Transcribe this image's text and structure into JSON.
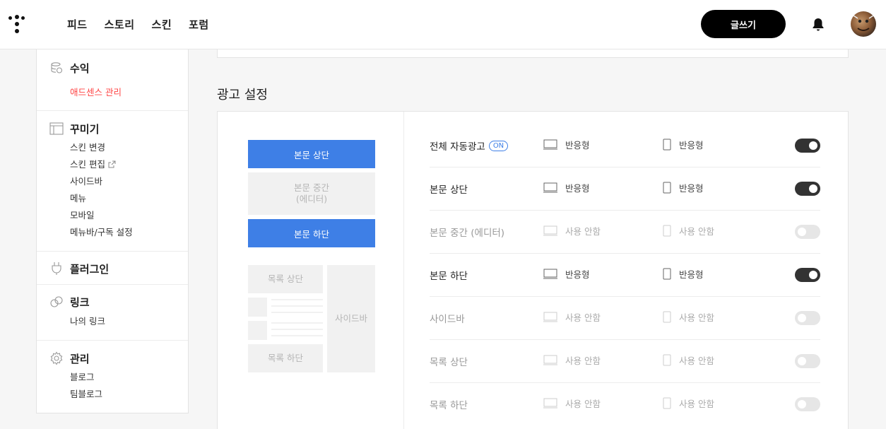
{
  "nav": [
    "피드",
    "스토리",
    "스킨",
    "포럼"
  ],
  "write_label": "글쓰기",
  "sidebar": {
    "revenue": {
      "title": "수익",
      "items": [
        "애드센스 관리"
      ]
    },
    "decorate": {
      "title": "꾸미기",
      "items": [
        "스킨 변경",
        "스킨 편집",
        "사이드바",
        "메뉴",
        "모바일",
        "메뉴바/구독 설정"
      ]
    },
    "plugin": {
      "title": "플러그인"
    },
    "link": {
      "title": "링크",
      "items": [
        "나의 링크"
      ]
    },
    "manage": {
      "title": "관리",
      "items": [
        "블로그",
        "팀블로그"
      ]
    }
  },
  "page_title": "광고 설정",
  "preview": {
    "body_top": "본문 상단",
    "body_middle": [
      "본문 중간",
      "(에디터)"
    ],
    "body_bottom": "본문 하단",
    "list_top": "목록 상단",
    "list_bottom": "목록 하단",
    "sidebar": "사이드바"
  },
  "on_badge": "ON",
  "rows": [
    {
      "label": "전체 자동광고",
      "badge": true,
      "pc": "반응형",
      "mobile": "반응형",
      "enabled": true
    },
    {
      "label": "본문 상단",
      "pc": "반응형",
      "mobile": "반응형",
      "enabled": true
    },
    {
      "label": "본문 중간 (에디터)",
      "pc": "사용 안함",
      "mobile": "사용 안함",
      "enabled": false
    },
    {
      "label": "본문 하단",
      "pc": "반응형",
      "mobile": "반응형",
      "enabled": true
    },
    {
      "label": "사이드바",
      "pc": "사용 안함",
      "mobile": "사용 안함",
      "enabled": false
    },
    {
      "label": "목록 상단",
      "pc": "사용 안함",
      "mobile": "사용 안함",
      "enabled": false
    },
    {
      "label": "목록 하단",
      "pc": "사용 안함",
      "mobile": "사용 안함",
      "enabled": false
    }
  ]
}
